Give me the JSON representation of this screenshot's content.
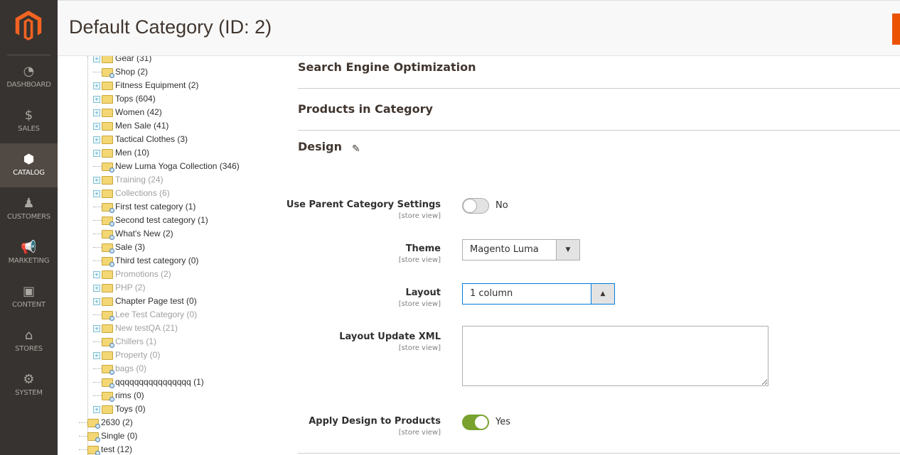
{
  "sidebar": {
    "items": [
      {
        "label": "DASHBOARD",
        "icon": "dashboard-icon",
        "glyph": "◔"
      },
      {
        "label": "SALES",
        "icon": "dollar-icon",
        "glyph": "$"
      },
      {
        "label": "CATALOG",
        "icon": "box-icon",
        "glyph": "⬢",
        "active": true
      },
      {
        "label": "CUSTOMERS",
        "icon": "person-icon",
        "glyph": "♟"
      },
      {
        "label": "MARKETING",
        "icon": "megaphone-icon",
        "glyph": "📢"
      },
      {
        "label": "CONTENT",
        "icon": "layout-icon",
        "glyph": "▣"
      },
      {
        "label": "STORES",
        "icon": "store-icon",
        "glyph": "⌂"
      },
      {
        "label": "SYSTEM",
        "icon": "gear-icon",
        "glyph": "⚙"
      }
    ]
  },
  "header": {
    "title": "Default Category (ID: 2)"
  },
  "tree": [
    {
      "label": "Gear (31)",
      "exp": true
    },
    {
      "label": "Shop (2)"
    },
    {
      "label": "Fitness Equipment (2)",
      "exp": true
    },
    {
      "label": "Tops (604)",
      "exp": true
    },
    {
      "label": "Women (42)",
      "exp": true
    },
    {
      "label": "Men Sale (41)",
      "exp": true
    },
    {
      "label": "Tactical Clothes (3)",
      "exp": true
    },
    {
      "label": "Men (10)",
      "exp": true
    },
    {
      "label": "New Luma Yoga Collection (346)"
    },
    {
      "label": "Training (24)",
      "exp": true,
      "dis": true
    },
    {
      "label": "Collections (6)",
      "exp": true,
      "dis": true
    },
    {
      "label": "First test category (1)"
    },
    {
      "label": "Second test category (1)"
    },
    {
      "label": "What's New (2)"
    },
    {
      "label": "Sale (3)"
    },
    {
      "label": "Third test category (0)"
    },
    {
      "label": "Promotions (2)",
      "exp": true,
      "dis": true
    },
    {
      "label": "PHP (2)",
      "exp": true,
      "dis": true
    },
    {
      "label": "Chapter Page test (0)",
      "exp": true
    },
    {
      "label": "Lee Test Category (0)",
      "dis": true
    },
    {
      "label": "New testQA (21)",
      "exp": true,
      "dis": true
    },
    {
      "label": "Chillers (1)",
      "dis": true
    },
    {
      "label": "Property (0)",
      "exp": true,
      "dis": true
    },
    {
      "label": "bags (0)",
      "dis": true
    },
    {
      "label": "qqqqqqqqqqqqqqqq (1)"
    },
    {
      "label": "rims (0)"
    },
    {
      "label": "Toys (0)",
      "exp": true
    },
    {
      "label": "2630 (2)",
      "root": true
    },
    {
      "label": "Single (0)",
      "root": true
    },
    {
      "label": "test (12)",
      "root": true
    }
  ],
  "sections": {
    "seo": "Search Engine Optimization",
    "products": "Products in Category",
    "design": "Design"
  },
  "form": {
    "use_parent": {
      "label": "Use Parent Category Settings",
      "scope": "[store view]",
      "value": "No",
      "on": false
    },
    "theme": {
      "label": "Theme",
      "scope": "[store view]",
      "value": "Magento Luma"
    },
    "layout": {
      "label": "Layout",
      "scope": "[store view]",
      "value": "1 column"
    },
    "layout_xml": {
      "label": "Layout Update XML",
      "scope": "[store view]",
      "value": ""
    },
    "apply": {
      "label": "Apply Design to Products",
      "scope": "[store view]",
      "value": "Yes",
      "on": true
    }
  },
  "colors": {
    "accent": "#eb5202",
    "sidebar": "#373330",
    "toggle_on": "#79a22e"
  }
}
